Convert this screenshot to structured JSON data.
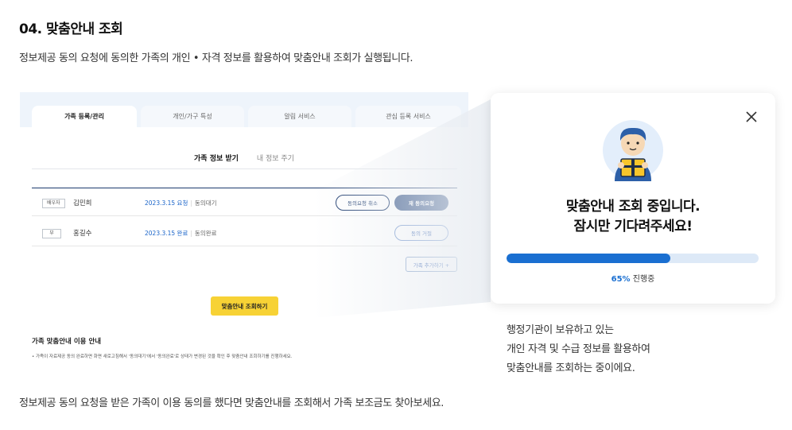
{
  "heading": "04. 맞춤안내 조회",
  "subtitle": "정보제공 동의 요청에 동의한 가족의 개인 • 자격 정보를 활용하여 맞춤안내 조회가 실행됩니다.",
  "footer": "정보제공 동의 요청을 받은 가족이 이용 동의를 했다면 맞춤안내를 조회해서 가족 보조금도 찾아보세요.",
  "mock": {
    "tabs": [
      "가족 등록/관리",
      "개인/가구 특성",
      "알림 서비스",
      "관심 등록 서비스"
    ],
    "subtabs": [
      "가족 정보 받기",
      "내 정보 주기"
    ],
    "rows": [
      {
        "relation": "배우자",
        "name": "김민희",
        "date": "2023.3.15 요청",
        "status": "동의대기",
        "btn1": "동의요청 취소",
        "btn2": "재 동의요청"
      },
      {
        "relation": "부",
        "name": "홍길수",
        "date": "2023.3.15 완료",
        "status": "동의완료",
        "btn1": "동의 거절"
      }
    ],
    "add_button": "가족 추가하기 +",
    "search_button": "맞춤안내 조회하기",
    "guide_title": "가족 맞춤안내 이용 안내",
    "guide_text": "• 가족이 자료제공 동의 완료하면 화면 새로고침해서 '동의대기'에서 '동의완료'로 상태가 변경된 것을 확인 후 맞춤안내 조회하기를 진행하세요."
  },
  "popup": {
    "title_line1": "맞춤안내 조회 중입니다.",
    "title_line2": "잠시만 기다려주세요!",
    "progress": 65,
    "progress_pct_label": "65%",
    "progress_label": "진행중",
    "close_icon": "close-icon",
    "mascot_icon": "mascot-holding-gift-icon"
  },
  "description": [
    "행정기관이 보유하고 있는",
    "개인 자격 및 수급 정보를 활용하여",
    "맞춤안내를 조회하는 중이에요."
  ],
  "colors": {
    "accent": "#1a6fd1",
    "navy": "#1d3b6e",
    "yellow": "#f7d235"
  }
}
